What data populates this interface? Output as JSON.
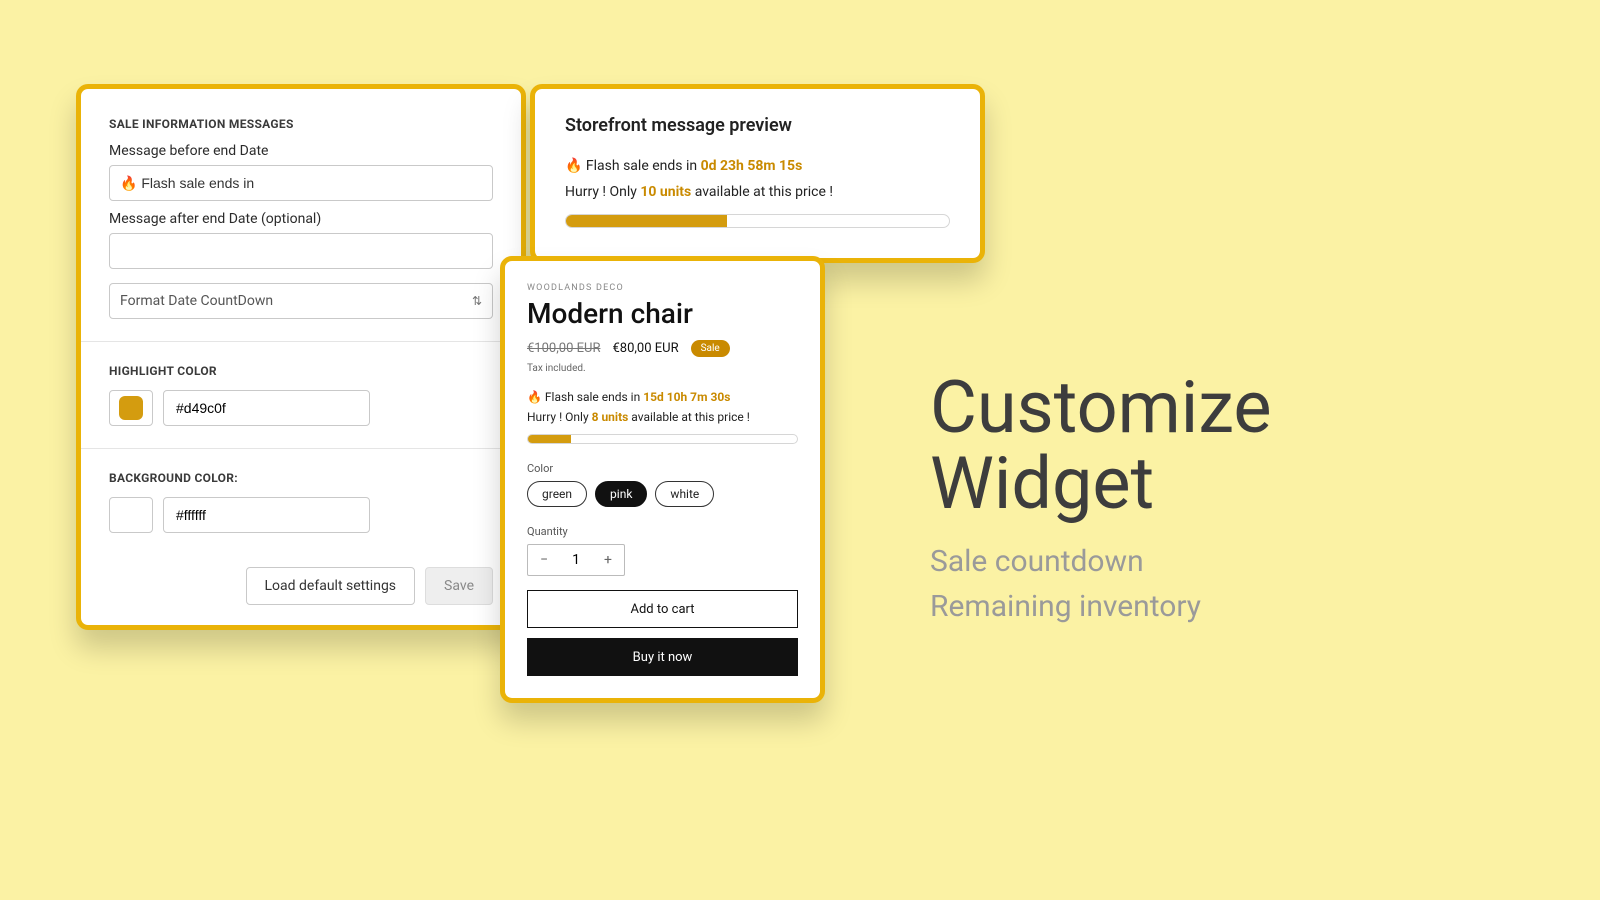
{
  "colors": {
    "accent": "#d49c0f",
    "bg": "#ffffff"
  },
  "settings": {
    "section_title": "SALE INFORMATION MESSAGES",
    "before_label": "Message before end Date",
    "before_value": "🔥 Flash sale ends in",
    "after_label": "Message after end Date (optional)",
    "after_value": "",
    "format_value": "Format Date CountDown",
    "highlight_label": "HIGHLIGHT COLOR",
    "highlight_hex": "#d49c0f",
    "background_label": "BACKGROUND COLOR:",
    "background_hex": "#ffffff",
    "btn_default": "Load default settings",
    "btn_save": "Save"
  },
  "preview": {
    "title": "Storefront message preview",
    "line1_prefix": "🔥 Flash sale ends in ",
    "line1_accent": "0d 23h 58m 15s",
    "line2_a": "Hurry ! Only ",
    "line2_units": "10 units",
    "line2_b": " available at this price !",
    "progress_pct": 42
  },
  "product": {
    "vendor": "WOODLANDS DECO",
    "title": "Modern chair",
    "compare_price": "€100,00 EUR",
    "price": "€80,00 EUR",
    "sale_chip": "Sale",
    "tax": "Tax included.",
    "msg1_prefix": "🔥 Flash sale ends in ",
    "msg1_accent": "15d 10h 7m 30s",
    "msg2_a": "Hurry ! Only ",
    "msg2_units": "8 units",
    "msg2_b": " available at this price !",
    "progress_pct": 16,
    "color_label": "Color",
    "colors": [
      "green",
      "pink",
      "white"
    ],
    "color_selected": "pink",
    "qty_label": "Quantity",
    "qty_value": "1",
    "add_to_cart": "Add to cart",
    "buy_now": "Buy it now"
  },
  "hero": {
    "line1": "Customize",
    "line2": "Widget",
    "sub1": "Sale countdown",
    "sub2": "Remaining inventory"
  }
}
